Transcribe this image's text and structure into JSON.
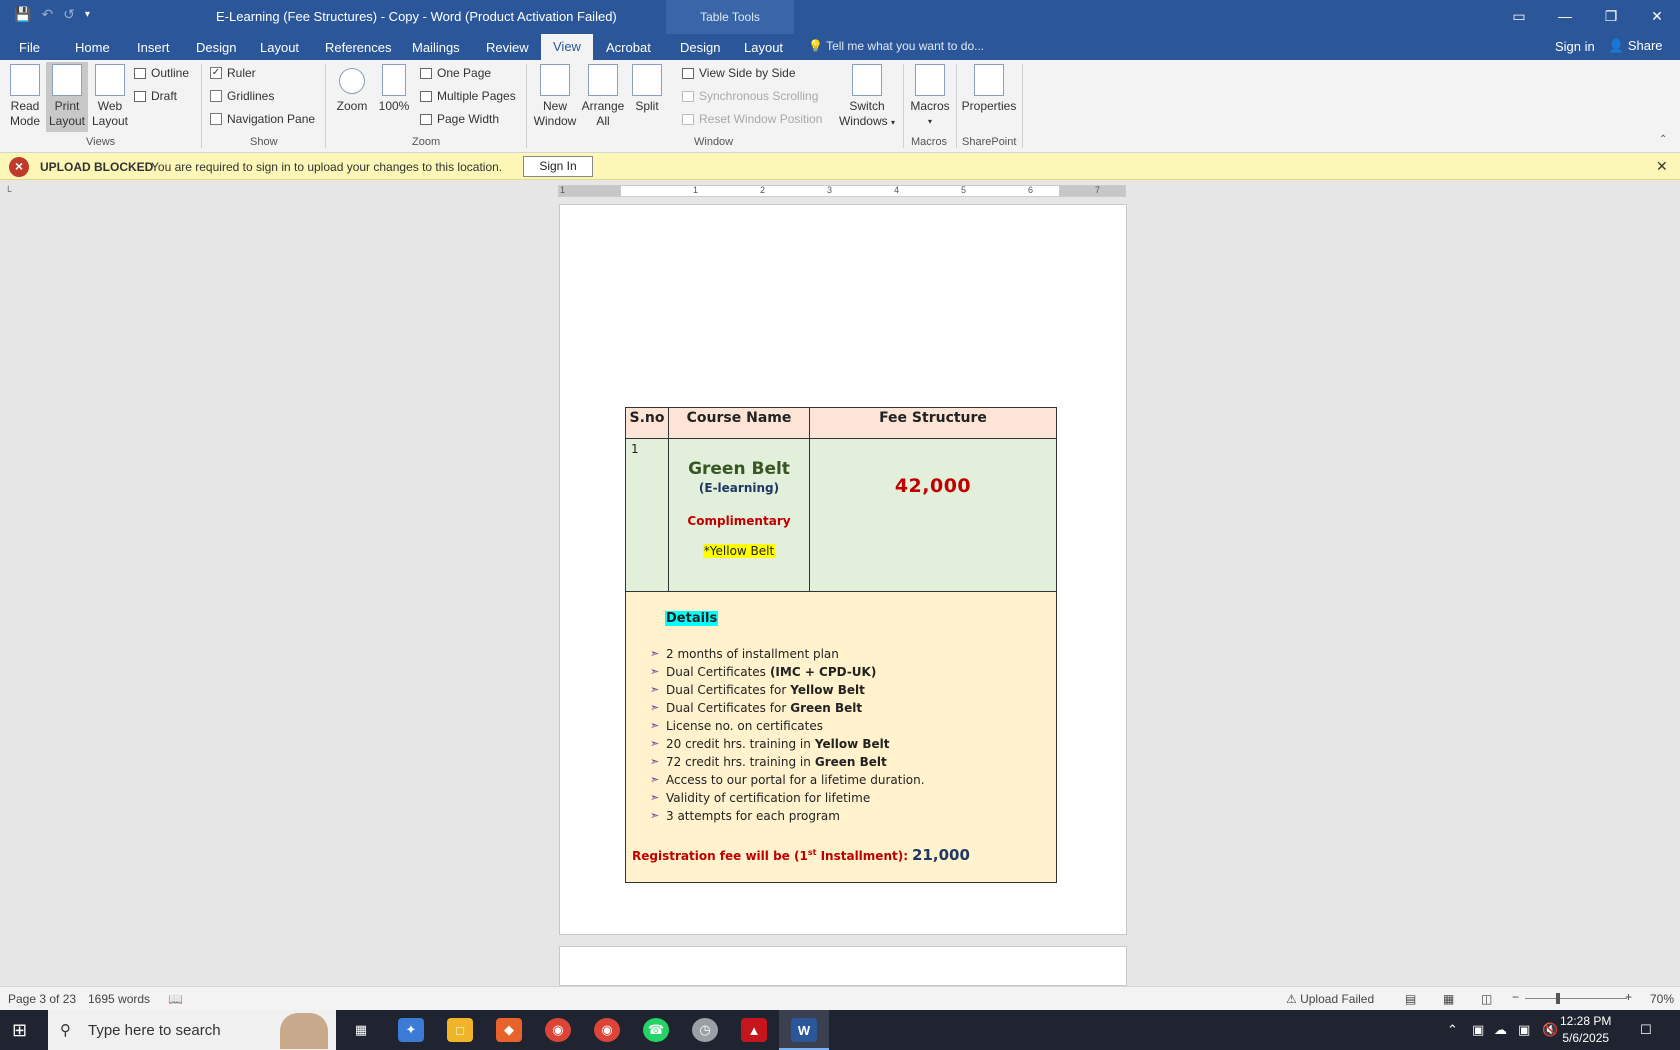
{
  "window": {
    "title": "E-Learning (Fee Structures) - Copy - Word (Product Activation Failed)",
    "contextual_tab": "Table Tools",
    "controls": [
      "▭",
      "—",
      "❐",
      "✕"
    ]
  },
  "tabs": [
    {
      "label": "File"
    },
    {
      "label": "Home"
    },
    {
      "label": "Insert"
    },
    {
      "label": "Design"
    },
    {
      "label": "Layout"
    },
    {
      "label": "References"
    },
    {
      "label": "Mailings"
    },
    {
      "label": "Review"
    },
    {
      "label": "View"
    },
    {
      "label": "Acrobat"
    },
    {
      "label": "Design"
    },
    {
      "label": "Layout"
    }
  ],
  "tellme": "Tell me what you want to do...",
  "sign_in": "Sign in",
  "share": "Share",
  "ribbon": {
    "views": {
      "read_mode": [
        "Read",
        "Mode"
      ],
      "print_layout": [
        "Print",
        "Layout"
      ],
      "web_layout": [
        "Web",
        "Layout"
      ],
      "outline": "Outline",
      "draft": "Draft",
      "label": "Views"
    },
    "show": {
      "ruler": "Ruler",
      "gridlines": "Gridlines",
      "navigation_pane": "Navigation Pane",
      "label": "Show",
      "ruler_checked": "✓"
    },
    "zoom": {
      "zoom": "Zoom",
      "hundred": "100%",
      "one_page": "One Page",
      "multiple_pages": "Multiple Pages",
      "page_width": "Page Width",
      "label": "Zoom"
    },
    "window": {
      "new_window": [
        "New",
        "Window"
      ],
      "arrange_all": [
        "Arrange",
        "All"
      ],
      "split": "Split",
      "side_by_side": "View Side by Side",
      "sync_scroll": "Synchronous Scrolling",
      "reset_pos": "Reset Window Position",
      "switch_windows": [
        "Switch",
        "Windows"
      ],
      "label": "Window"
    },
    "macros": {
      "macros": "Macros",
      "label": "Macros"
    },
    "sharepoint": {
      "properties": "Properties",
      "label": "SharePoint"
    }
  },
  "message_bar": {
    "title": "UPLOAD BLOCKED",
    "text": "You are required to sign in to upload your changes to this location.",
    "button": "Sign In"
  },
  "ruler_numbers": [
    "1",
    "1",
    "2",
    "3",
    "4",
    "5",
    "6",
    "7"
  ],
  "document": {
    "headers": [
      "S.no",
      "Course Name",
      "Fee Structure"
    ],
    "row": {
      "sno": "1",
      "course": "Green Belt",
      "course_sub": "(E-learning)",
      "complimentary": "Complimentary",
      "bonus": "*Yellow Belt",
      "fee": "42,000"
    },
    "details_title": "Details",
    "details": [
      {
        "text": "2 months of installment plan",
        "bold": ""
      },
      {
        "text": "Dual Certificates",
        "bold": "(IMC + CPD-UK)"
      },
      {
        "text": "Dual Certificates for",
        "bold": "Yellow Belt"
      },
      {
        "text": "Dual Certificates for",
        "bold": "Green Belt"
      },
      {
        "text": "License no. on certificates",
        "bold": ""
      },
      {
        "text": "20 credit hrs. training in",
        "bold": "Yellow Belt"
      },
      {
        "text": "72 credit hrs. training in",
        "bold": "Green Belt"
      },
      {
        "text": "Access to our portal for a lifetime duration.",
        "bold": ""
      },
      {
        "text": "Validity of certification for lifetime",
        "bold": ""
      },
      {
        "text": "3 attempts for each program",
        "bold": ""
      }
    ],
    "registration": {
      "prefix": "Registration fee will be (1",
      "sup": "st",
      "suffix": " Installment):",
      "amount": "21,000"
    }
  },
  "status_bar": {
    "page": "Page 3 of 23",
    "words": "1695 words",
    "upload": "Upload Failed",
    "zoom": "70%"
  },
  "taskbar": {
    "search_placeholder": "Type here to search",
    "time": "12:28 PM",
    "date": "5/6/2025"
  }
}
